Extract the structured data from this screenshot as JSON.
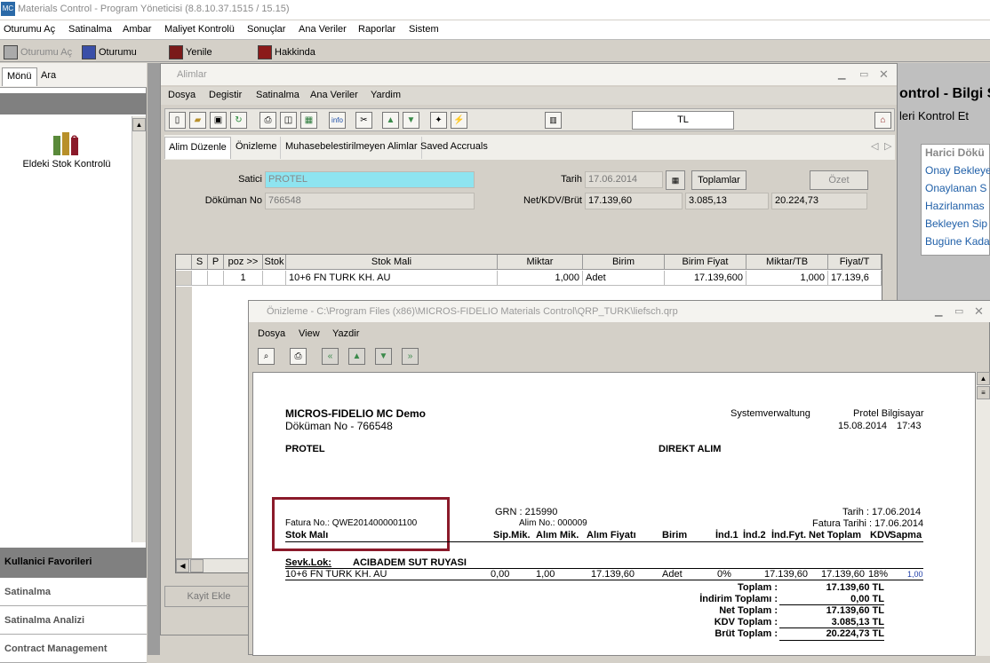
{
  "app": {
    "title": "Materials Control - Program Yöneticisi (8.8.10.37.1515 / 15.15)",
    "logo": "MC"
  },
  "menubar": [
    "Oturumu Aç",
    "Satinalma",
    "Ambar",
    "Maliyet Kontrolü",
    "Sonuçlar",
    "Ana Veriler",
    "Raporlar",
    "Sistem"
  ],
  "toolbar": {
    "login": "Oturumu Aç",
    "logout": "Oturumu",
    "refresh": "Yenile",
    "about": "Hakkinda"
  },
  "left": {
    "tabs": [
      "Mönü",
      "Ara"
    ],
    "tree_item": "Eldeki Stok Kontrolü",
    "favorites_header": "Kullanici Favorileri",
    "favorites": [
      "Satinalma",
      "Satinalma Analizi",
      "Contract Management"
    ]
  },
  "right": {
    "big_title": "ontrol - Bilgi S",
    "subtitle": "leri Kontrol Et",
    "harici_title": "Harici Dökü",
    "links": [
      "Onay Bekleye",
      "Onaylanan S",
      "Hazirlanmas",
      "Bekleyen Sip",
      "Bugüne Kada"
    ]
  },
  "alimlar": {
    "title": "Alimlar",
    "menu": [
      "Dosya",
      "Degistir",
      "Satinalma",
      "Ana Veriler",
      "Yardim"
    ],
    "currency": "TL",
    "tabs": [
      "Alim Düzenle",
      "Önizleme",
      "Muhasebelestirilmeyen Alimlar",
      "Saved Accruals"
    ],
    "form": {
      "satici_label": "Satici",
      "satici": "PROTEL",
      "dokuman_label": "Döküman No",
      "dokuman": "766548",
      "tarih_label": "Tarih",
      "tarih": "17.06.2014",
      "toplamlar": "Toplamlar",
      "ozet": "Özet",
      "net_label": "Net/KDV/Brüt",
      "net": "17.139,60",
      "kdv": "3.085,13",
      "brut": "20.224,73"
    },
    "grid": {
      "headers": [
        "S",
        "P",
        "poz >>",
        "Stok",
        "Stok Mali",
        "Miktar",
        "Birim",
        "Birim Fiyat",
        "Miktar/TB",
        "Fiyat/T"
      ],
      "rows": [
        [
          "",
          "",
          "1",
          "",
          "10+6 FN TURK KH. AU",
          "1,000",
          "Adet",
          "17.139,600",
          "1,000",
          "17.139,6"
        ]
      ]
    },
    "kayit_ekle": "Kayit Ekle"
  },
  "onizleme": {
    "title": "Önizleme - C:\\Program Files (x86)\\MICROS-FIDELIO Materials Control\\QRP_TURK\\liefsch.qrp",
    "menu": [
      "Dosya",
      "View",
      "Yazdir"
    ],
    "report": {
      "company": "MICROS-FIDELIO MC Demo",
      "doc": "Döküman No - 766548",
      "system": "Systemverwaltung",
      "protel": "Protel Bilgisayar",
      "date": "15.08.2014",
      "time": "17:43",
      "supplier": "PROTEL",
      "type": "DIREKT ALIM",
      "grn": "GRN : 215990",
      "tarih": "Tarih : 17.06.2014",
      "fatura_no": "Fatura No.: QWE2014000001100",
      "alim_no": "Alim No.: 000009",
      "fatura_tarihi": "Fatura Tarihi : 17.06.2014",
      "cols": [
        "Stok Malı",
        "Sip.Mik.",
        "Alım Mik.",
        "Alım Fiyatı",
        "Birim",
        "İnd.1",
        "İnd.2",
        "İnd.Fyt.",
        "Net Toplam",
        "KDV",
        "Sapma"
      ],
      "sevk_label": "Sevk.Lok:",
      "sevk_value": "ACIBADEM SUT RUYASI",
      "row": [
        "10+6 FN TURK KH. AU",
        "0,00",
        "1,00",
        "17.139,60",
        "Adet",
        "0%",
        "17.139,60",
        "17.139,60",
        "18%",
        "1,00"
      ],
      "totals": [
        {
          "label": "Toplam :",
          "value": "17.139,60 TL"
        },
        {
          "label": "İndirim Toplamı :",
          "value": "0,00 TL"
        },
        {
          "label": "Net Toplam :",
          "value": "17.139,60 TL"
        },
        {
          "label": "KDV Toplam :",
          "value": "3.085,13 TL"
        },
        {
          "label": "Brüt Toplam :",
          "value": "20.224,73 TL"
        }
      ]
    }
  }
}
